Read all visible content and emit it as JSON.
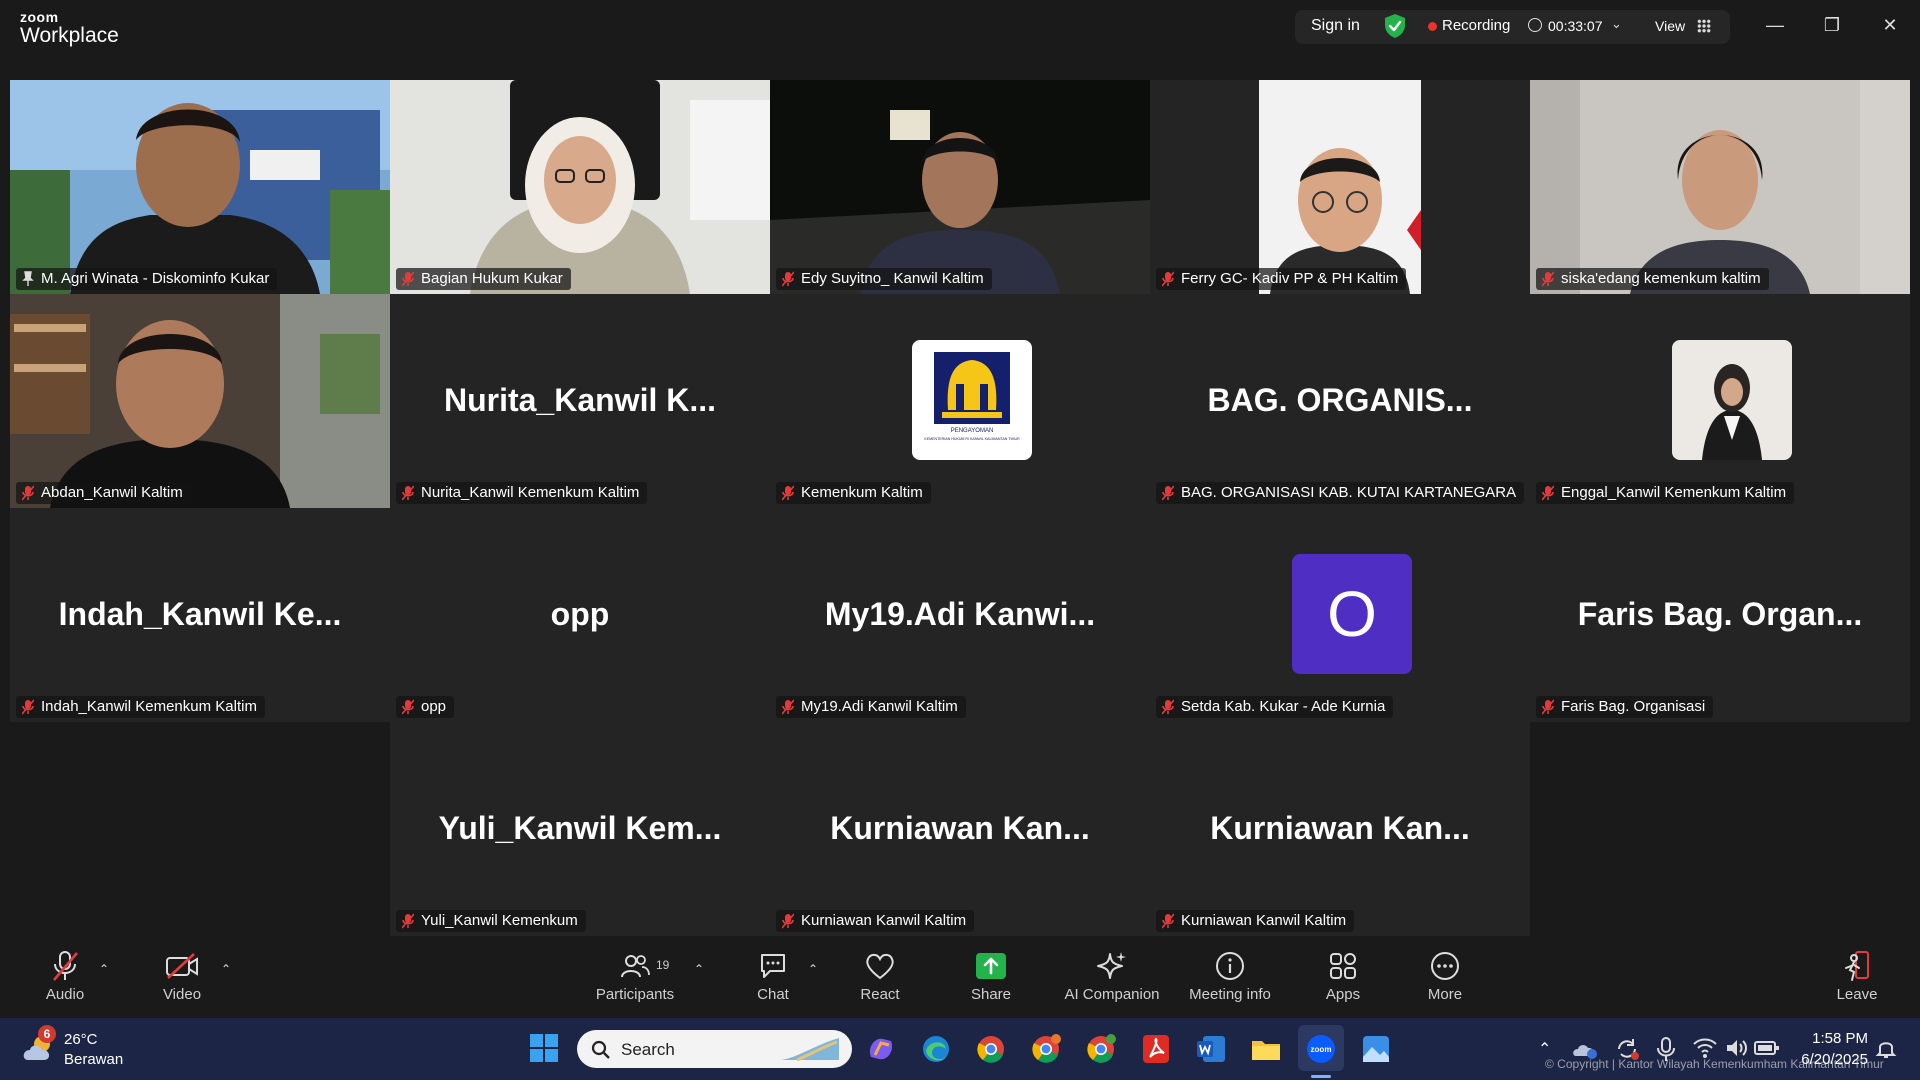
{
  "titlebar": {
    "brand_top": "zoom",
    "brand_bottom": "Workplace",
    "sign_in": "Sign in",
    "recording": "Recording",
    "timer": "00:33:07",
    "view": "View"
  },
  "tiles": [
    {
      "label": "M. Agri Winata - Diskominfo Kukar",
      "big": "",
      "type": "video",
      "active": true,
      "pinned": true
    },
    {
      "label": "Bagian Hukum Kukar",
      "big": "",
      "type": "video"
    },
    {
      "label": "Edy Suyitno_ Kanwil Kaltim",
      "big": "",
      "type": "video"
    },
    {
      "label": "Ferry GC- Kadiv PP & PH Kaltim",
      "big": "",
      "type": "video"
    },
    {
      "label": "siska'edang kemenkum kaltim",
      "big": "",
      "type": "video"
    },
    {
      "label": "Abdan_Kanwil Kaltim",
      "big": "",
      "type": "video"
    },
    {
      "label": "Nurita_Kanwil Kemenkum Kaltim",
      "big": "Nurita_Kanwil  K...",
      "type": "name"
    },
    {
      "label": "Kemenkum Kaltim",
      "big": "",
      "type": "logo",
      "logo_text": "PENGAYOMAN",
      "logo_sub": "KEMENTERIAN HUKUM RI KANWIL KALIMANTAN TIMUR"
    },
    {
      "label": "BAG. ORGANISASI KAB. KUTAI KARTANEGARA",
      "big": "BAG.  ORGANIS...",
      "type": "name"
    },
    {
      "label": "Enggal_Kanwil Kemenkum Kaltim",
      "big": "",
      "type": "photo"
    },
    {
      "label": "Indah_Kanwil Kemenkum Kaltim",
      "big": "Indah_Kanwil  Ke...",
      "type": "name"
    },
    {
      "label": "opp",
      "big": "opp",
      "type": "name"
    },
    {
      "label": "My19.Adi Kanwil Kaltim",
      "big": "My19.Adi  Kanwi...",
      "type": "name"
    },
    {
      "label": "Setda Kab. Kukar - Ade Kurnia",
      "big": "",
      "type": "initial",
      "initial": "O",
      "initial_color": "#4f2ec4"
    },
    {
      "label": "Faris Bag. Organisasi",
      "big": "Faris  Bag.  Organ...",
      "type": "name"
    },
    {
      "label": "Yuli_Kanwil Kemenkum",
      "big": "Yuli_Kanwil  Kem...",
      "type": "name"
    },
    {
      "label": "Kurniawan Kanwil Kaltim",
      "big": "Kurniawan  Kan...",
      "type": "name"
    },
    {
      "label": "Kurniawan Kanwil Kaltim",
      "big": "Kurniawan  Kan...",
      "type": "name"
    }
  ],
  "toolbar": {
    "audio": "Audio",
    "video": "Video",
    "participants": "Participants",
    "participants_count": "19",
    "chat": "Chat",
    "react": "React",
    "share": "Share",
    "ai_companion": "AI Companion",
    "meeting_info": "Meeting info",
    "apps": "Apps",
    "more": "More",
    "leave": "Leave"
  },
  "taskbar": {
    "weather_badge": "6",
    "temperature": "26°C",
    "condition": "Berawan",
    "search": "Search",
    "time": "1:58 PM",
    "date": "6/20/2025",
    "copyright": "© Copyright | Kantor Wilayah Kemenkumham Kalimantan Timur"
  },
  "colors": {
    "accent_green": "#23d959",
    "recording_red": "#e8342c",
    "share_green": "#23b34a",
    "taskbar_bg": "#1c2545"
  }
}
